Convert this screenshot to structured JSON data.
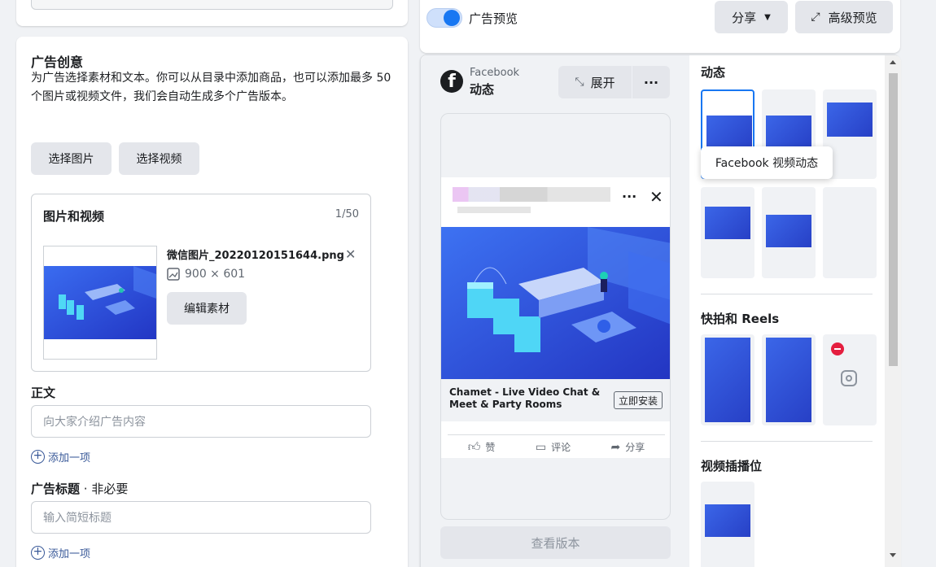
{
  "creative": {
    "title": "广告创意",
    "description": "为广告选择素材和文本。你可以从目录中添加商品，也可以添加最多 50 个图片或视频文件，我们会自动生成多个广告版本。",
    "select_image": "选择图片",
    "select_video": "选择视频",
    "media_title": "图片和视频",
    "media_count": "1/50",
    "file_name": "微信图片_20220120151644.png",
    "file_dims": "900 × 601",
    "edit_label": "编辑素材",
    "body_label": "正文",
    "body_placeholder": "向大家介绍广告内容",
    "add_item": "添加一项",
    "headline_label": "广告标题",
    "headline_optional": " · 非必要",
    "headline_placeholder": "输入简短标题",
    "add_item2": "添加一项"
  },
  "preview": {
    "toggle_label": "广告预览",
    "share": "分享",
    "advanced": "高级预览",
    "platform": "Facebook",
    "placement": "动态",
    "expand": "展开",
    "more": "···",
    "cta_title": "Chamet - Live Video Chat & Meet & Party Rooms",
    "cta_button": "立即安装",
    "like": "赞",
    "comment": "评论",
    "share_action": "分享",
    "view_version": "查看版本"
  },
  "placements": {
    "feeds": "动态",
    "tooltip": "Facebook 视频动态",
    "stories": "快拍和 Reels",
    "instream": "视频插播位"
  },
  "colors": {
    "accent": "#1877f2",
    "link": "#385898"
  }
}
